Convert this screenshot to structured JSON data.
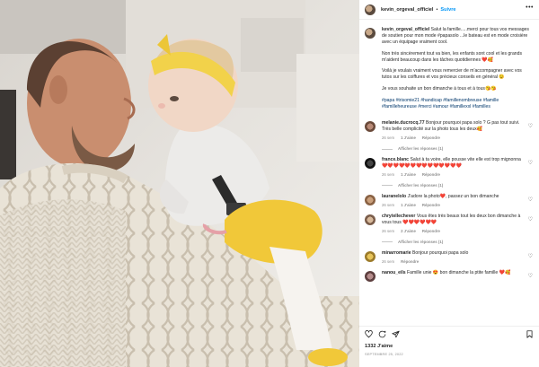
{
  "post": {
    "username": "kevin_orgeval_officiel",
    "dot": "•",
    "follow_label": "Suivre",
    "more_icon": "more-icon",
    "caption_user": "kevin_orgeval_officiel",
    "caption_p1": "Salut la famille.....merci pour tous vos messages de soutien pour mon mode #papasolo ...le bateau est en mode croisière avec un équipage vraiment cool.",
    "caption_p2": "Non très sincèrement tout va bien, les enfants sont cool et les grands m'aident beaucoup dans les tâches quotidiennes ❤️🥰",
    "caption_p3": "Voilà je voulais vraiment vous remercier de m'accompagner avec vos tutos sur les coiffures et vos précieux conseils en général 😉",
    "caption_p4": "Je vous souhaite un bon dimanche à tous et à tous😘😘",
    "hashtags": "#papa #trisomie21 #handicap #famillenombreuse #famille #familleheureuse #merci #amour #famillexxl #familles"
  },
  "comments": [
    {
      "user": "melanie.ducrocq.77",
      "text": "Bonjour pourquoi papa solo ? G pas tout suivi. Très belle complicité sur la photo tous les deux🥰",
      "time": "26 sem",
      "likes": "1 J'aime",
      "reply": "Répondre",
      "view_replies": "Afficher les réponses (1)"
    },
    {
      "user": "france.blanc",
      "text": "Salut à ta voire, elle pousse vite elle est trop mignonna ❤️❤️❤️❤️❤️❤️❤️❤️❤️❤️❤️❤️❤️❤️",
      "time": "26 sem",
      "likes": "1 J'aime",
      "reply": "Répondre",
      "view_replies": "Afficher les réponses (1)"
    },
    {
      "user": "lauranelolo",
      "text": "J'adore la photo❤️, passez un bon dimanche",
      "time": "26 sem",
      "likes": "1 J'aime",
      "reply": "Répondre",
      "view_replies": ""
    },
    {
      "user": "chrytellechever",
      "text": "Vous êtes très beaux tout les deux bon dimanche à vous tous ❤️❤️❤️❤️❤️❤️",
      "time": "26 sem",
      "likes": "2 J'aime",
      "reply": "Répondre",
      "view_replies": "Afficher les réponses (1)"
    },
    {
      "user": "minarromarie",
      "text": "Bonjour pourquoi papa solo",
      "time": "26 sem",
      "likes": "",
      "reply": "Répondre",
      "view_replies": ""
    },
    {
      "user": "nanou_eils",
      "text": "Famille unie 😍 bon dimanche la ptite famille ❤️🥰",
      "time": "",
      "likes": "",
      "reply": "",
      "view_replies": ""
    }
  ],
  "footer": {
    "likes": "1332 J'aime",
    "date": "SEPTEMBRE 25, 2022",
    "icons": [
      "heart-icon",
      "comment-icon",
      "share-icon",
      "bookmark-icon"
    ]
  },
  "colors": {
    "follow": "#0095f6",
    "hashtag": "#00376b",
    "muted": "#8e8e8e"
  }
}
